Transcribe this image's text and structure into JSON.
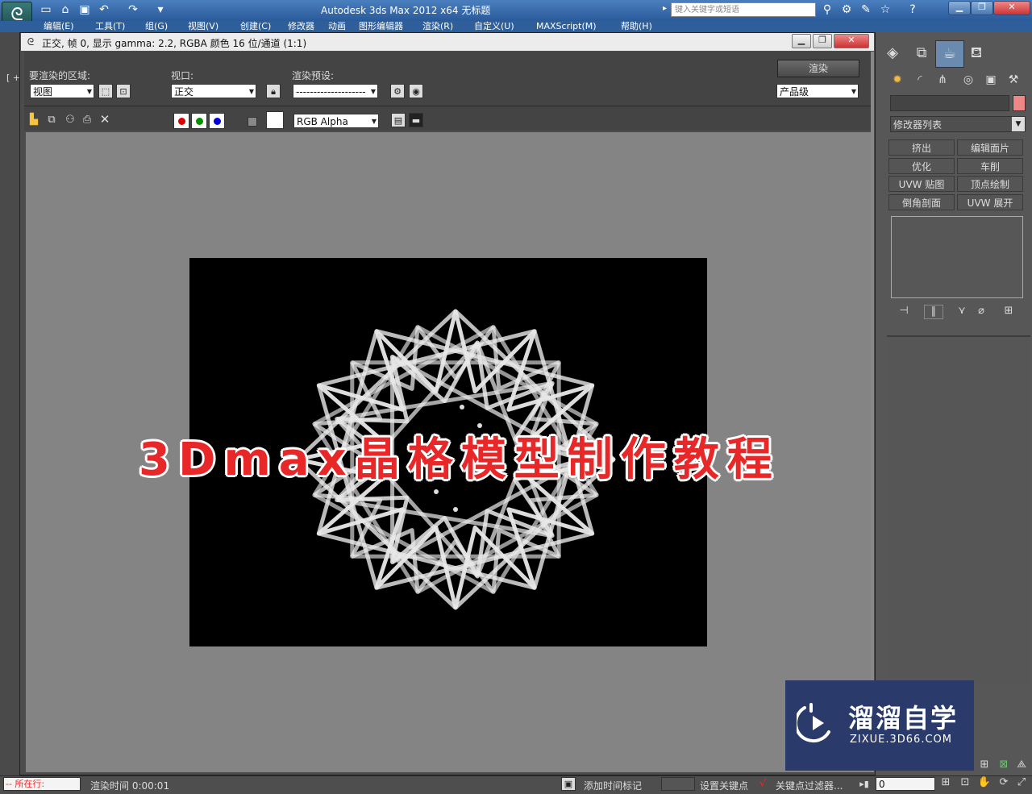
{
  "app": {
    "title": "Autodesk 3ds Max  2012 x64      无标题",
    "search_placeholder": "键入关键字或短语"
  },
  "menu": [
    "编辑(E)",
    "工具(T)",
    "组(G)",
    "视图(V)",
    "创建(C)",
    "修改器",
    "动画",
    "图形编辑器",
    "渲染(R)",
    "自定义(U)",
    "MAXScript(M)",
    "帮助(H)"
  ],
  "render_frame": {
    "title": "正交, 帧 0, 显示 gamma: 2.2, RGBA 颜色 16 位/通道 (1:1)",
    "area_label": "要渲染的区域:",
    "area_value": "视图",
    "viewport_label": "视口:",
    "viewport_value": "正交",
    "preset_label": "渲染预设:",
    "preset_value": "--------------------",
    "render_button": "渲染",
    "quality_value": "产品级",
    "channel_value": "RGB Alpha",
    "channel_colors": {
      "red": "#e00000",
      "green": "#009000",
      "blue": "#0000e0"
    }
  },
  "overlay_title": "3Dmax晶格模型制作教程",
  "command_panel": {
    "modifier_list": "修改器列表",
    "buttons": [
      "挤出",
      "编辑面片",
      "优化",
      "车削",
      "UVW 贴图",
      "顶点绘制",
      "倒角剖面",
      "UVW 展开"
    ]
  },
  "watermark": {
    "name": "溜溜自学",
    "url": "ZIXUE.3D66.COM"
  },
  "status": {
    "left_label": "所在行:",
    "render_time": "渲染时间 0:00:01",
    "add_time_tag": "添加时间标记",
    "set_key": "设置关键点",
    "key_filter": "关键点过滤器...",
    "frame_value": "0"
  },
  "colors": {
    "accent": "#e82828",
    "title_bar": "#2a5a99",
    "watermark_bg": "#2a3a6a"
  }
}
